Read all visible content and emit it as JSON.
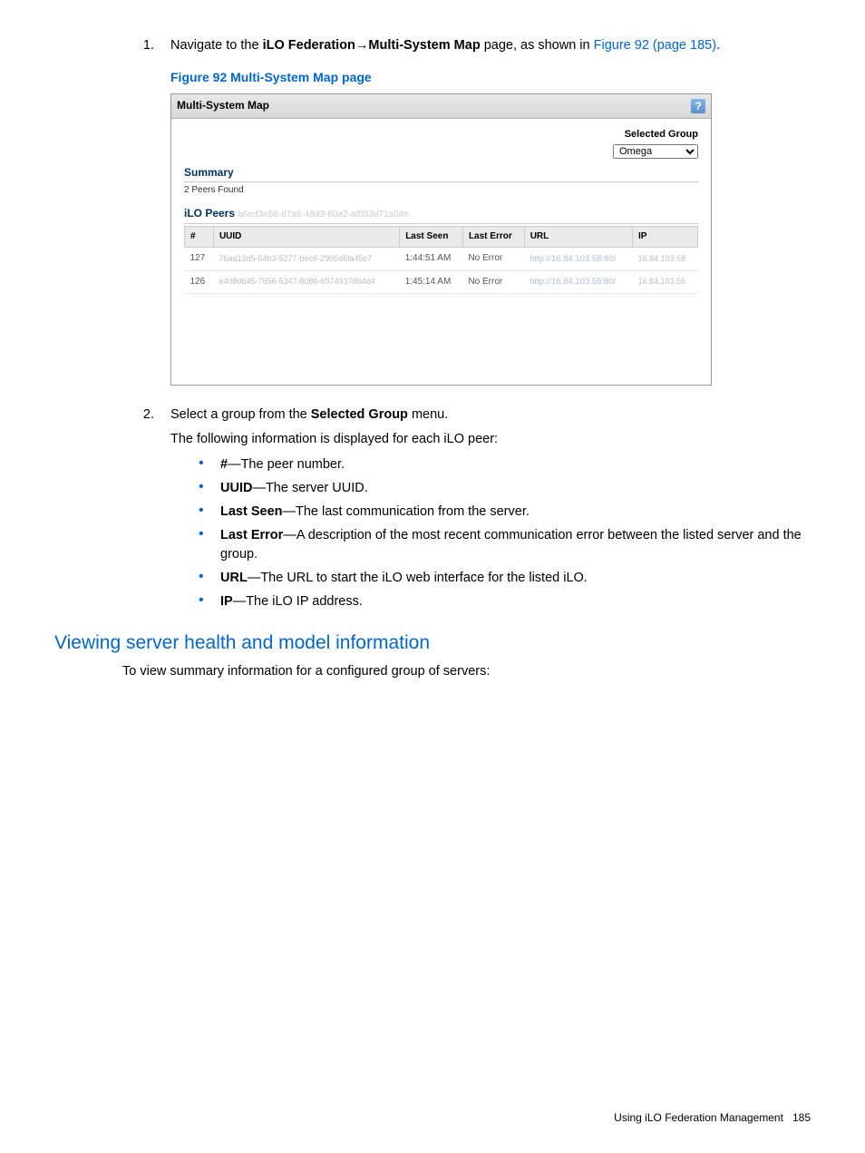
{
  "step1": {
    "num": "1.",
    "text_pre": "Navigate to the ",
    "bold1": "iLO Federation",
    "arrow": "→",
    "bold2": "Multi-System Map",
    "text_mid": " page, as shown in ",
    "link": "Figure 92 (page 185)",
    "text_post": "."
  },
  "figure_caption": "Figure 92 Multi-System Map page",
  "screenshot": {
    "title": "Multi-System Map",
    "help": "?",
    "group_label": "Selected Group",
    "group_value": "Omega",
    "summary_hdr": "Summary",
    "peers_found": "2 Peers Found",
    "peers_hdr": "iLO Peers",
    "peers_hdr_faded": "a6ed3e58-d7a6-48d3-80a2-a8f83d71a04e",
    "columns": [
      "#",
      "UUID",
      "Last Seen",
      "Last Error",
      "URL",
      "IP"
    ],
    "rows": [
      {
        "num": "127",
        "uuid": "76aa13d5-54b3-5277-bec6-2905d6fa45c7",
        "last_seen": "1:44:51 AM",
        "last_error": "No Error",
        "url": "http://16.84.103.58:80/",
        "ip": "16.84.103.58"
      },
      {
        "num": "126",
        "uuid": "e408d645-7556-5347-8086-6974937864d4",
        "last_seen": "1:45:14 AM",
        "last_error": "No Error",
        "url": "http://16.84.103.55:80/",
        "ip": "16.84.103.55"
      }
    ]
  },
  "step2": {
    "num": "2.",
    "text_pre": "Select a group from the ",
    "bold": "Selected Group",
    "text_post": " menu.",
    "line2": "The following information is displayed for each iLO peer:"
  },
  "bullets": [
    {
      "bold": "#",
      "rest": "—The peer number."
    },
    {
      "bold": "UUID",
      "rest": "—The server UUID."
    },
    {
      "bold": "Last Seen",
      "rest": "—The last communication from the server."
    },
    {
      "bold": "Last Error",
      "rest": "—A description of the most recent communication error between the listed server and the group."
    },
    {
      "bold": "URL",
      "rest": "—The URL to start the iLO web interface for the listed iLO."
    },
    {
      "bold": "IP",
      "rest": "—The iLO IP address."
    }
  ],
  "section_heading": "Viewing server health and model information",
  "section_text": "To view summary information for a configured group of servers:",
  "footer_text": "Using iLO Federation Management",
  "footer_page": "185"
}
